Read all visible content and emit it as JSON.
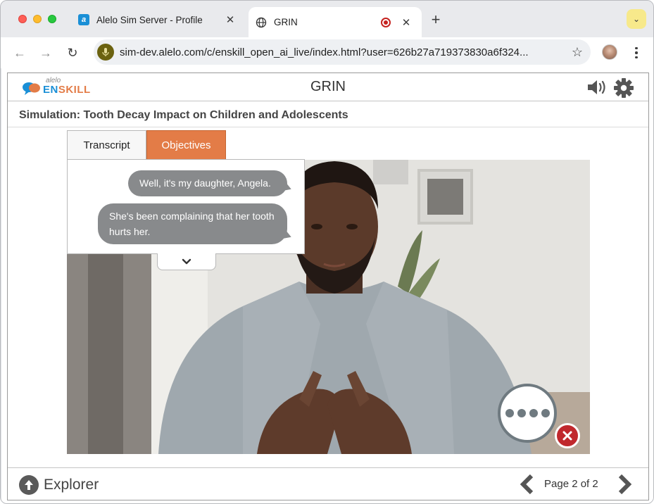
{
  "browser": {
    "tabs": [
      {
        "title": "Alelo Sim Server - Profile",
        "favicon": "alelo-icon",
        "close": "✕"
      },
      {
        "title": "GRIN",
        "favicon": "globe-icon",
        "close": "✕",
        "active": true
      }
    ],
    "new_tab": "+",
    "tab_search": "⌄",
    "url": "sim-dev.alelo.com/c/enskill_open_ai_live/index.html?user=626b27a719373830a6f324...",
    "icons": {
      "back": "←",
      "forward": "→",
      "reload": "↻",
      "bookmark": "☆"
    },
    "colors": {
      "tab_search_bg": "#f7e98b",
      "mic_badge": "#6b6210"
    }
  },
  "app": {
    "logo": {
      "brand": "alelo",
      "product": "ENSKILL",
      "colors": {
        "en": "#1a8fd6",
        "skill": "#e37c47"
      }
    },
    "title": "GRIN",
    "simulation_title": "Simulation: Tooth Decay Impact on Children and Adolescents",
    "tabs": {
      "transcript": "Transcript",
      "objectives": "Objectives"
    },
    "transcript": [
      "Well, it's my daughter, Angela.",
      "She's been complaining that her tooth hurts her."
    ],
    "footer": {
      "explorer": "Explorer",
      "page": "Page 2 of 2"
    },
    "colors": {
      "accent": "#e37c47",
      "bubble": "#888a8c",
      "close": "#c0282d"
    }
  }
}
